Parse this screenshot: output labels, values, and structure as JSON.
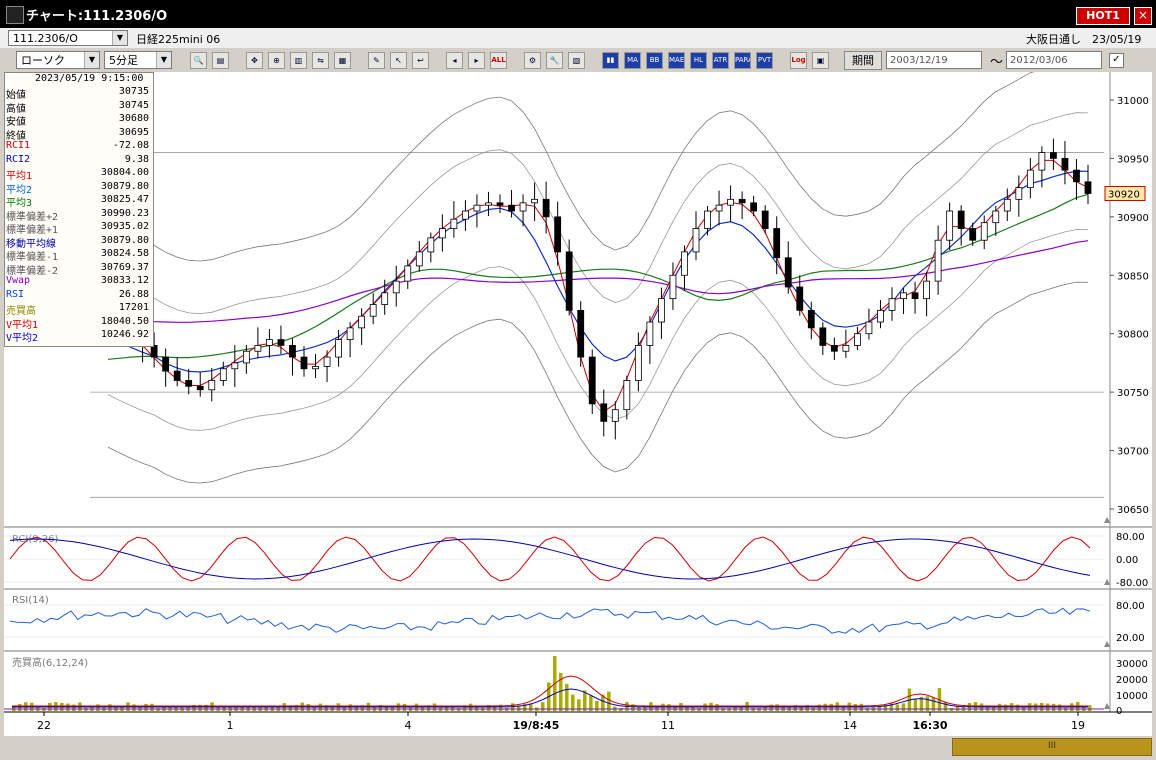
{
  "window": {
    "title": "チャート:111.2306/O",
    "hot_label": "HOT1",
    "close_label": "×"
  },
  "symbol": {
    "code": "111.2306/O",
    "instrument": "日経225mini 06",
    "exchange_date": "大阪日通し　23/05/19"
  },
  "controls": {
    "chart_type": "ローソク",
    "interval": "5分足",
    "period_label": "期間",
    "date_from": "2003/12/19",
    "date_to": "2012/03/06",
    "tilde": "～",
    "toolbar_buttons": [
      {
        "icon": "search-icon",
        "text": "🔍"
      },
      {
        "icon": "split-icon",
        "text": "▤"
      },
      {
        "icon": "cross-icon",
        "text": "✥"
      },
      {
        "icon": "zoom-icon",
        "text": "⊕"
      },
      {
        "icon": "bars-icon",
        "text": "▥"
      },
      {
        "icon": "compare-icon",
        "text": "⇋"
      },
      {
        "icon": "note-icon",
        "text": "▦"
      },
      {
        "icon": "pen-icon",
        "text": "✎"
      },
      {
        "icon": "cursor-icon",
        "text": "↖"
      },
      {
        "icon": "arrow-icon",
        "text": "↩"
      },
      {
        "icon": "candle-left-icon",
        "text": "◂"
      },
      {
        "icon": "candle-right-icon",
        "text": "▸"
      },
      {
        "icon": "all-icon",
        "text": "ALL"
      },
      {
        "icon": "settings-icon",
        "text": "⚙"
      },
      {
        "icon": "wrench-icon",
        "text": "🔧"
      },
      {
        "icon": "palette-icon",
        "text": "▧"
      },
      {
        "icon": "vol-icon",
        "text": "▮▮"
      },
      {
        "icon": "ma-icon",
        "text": "MA"
      },
      {
        "icon": "bb-icon",
        "text": "BB"
      },
      {
        "icon": "mae-icon",
        "text": "MAE"
      },
      {
        "icon": "hl-icon",
        "text": "HL"
      },
      {
        "icon": "atr-icon",
        "text": "ATR"
      },
      {
        "icon": "para-icon",
        "text": "PARA"
      },
      {
        "icon": "pvt-icon",
        "text": "PVT"
      },
      {
        "icon": "log-icon",
        "text": "Log"
      },
      {
        "icon": "window-icon",
        "text": "▣"
      }
    ]
  },
  "info_panel": {
    "datetime": "2023/05/19 9:15:00",
    "rows": [
      {
        "label": "始値",
        "value": "30735",
        "color": "#000000"
      },
      {
        "label": "高値",
        "value": "30745",
        "color": "#000000"
      },
      {
        "label": "安値",
        "value": "30680",
        "color": "#000000"
      },
      {
        "label": "終値",
        "value": "30695",
        "color": "#000000"
      },
      {
        "label": "RCI1",
        "value": "-72.08",
        "color": "#cc0000"
      },
      {
        "label": "RCI2",
        "value": "9.38",
        "color": "#0000cc"
      },
      {
        "label": "平均1",
        "value": "30804.00",
        "color": "#cc0000"
      },
      {
        "label": "平均2",
        "value": "30879.80",
        "color": "#0066cc"
      },
      {
        "label": "平均3",
        "value": "30825.47",
        "color": "#007700"
      },
      {
        "label": "標準偏差+2",
        "value": "30990.23",
        "color": "#555555"
      },
      {
        "label": "標準偏差+1",
        "value": "30935.02",
        "color": "#555555"
      },
      {
        "label": "移動平均線",
        "value": "30879.80",
        "color": "#0000aa"
      },
      {
        "label": "標準偏差-1",
        "value": "30824.58",
        "color": "#555555"
      },
      {
        "label": "標準偏差-2",
        "value": "30769.37",
        "color": "#555555"
      },
      {
        "label": "Vwap",
        "value": "30833.12",
        "color": "#8800cc"
      },
      {
        "label": "RSI",
        "value": "26.88",
        "color": "#0044cc"
      },
      {
        "label": "売買高",
        "value": "17201",
        "color": "#888800"
      },
      {
        "label": "V平均1",
        "value": "18040.50",
        "color": "#cc0000"
      },
      {
        "label": "V平均2",
        "value": "10246.92",
        "color": "#0000cc"
      }
    ]
  },
  "chart_data": [
    {
      "type": "candlestick",
      "title": "",
      "ylim": [
        30650,
        31000
      ],
      "y_ticks": [
        "31000",
        "30950",
        "30900",
        "30850",
        "30800",
        "30750",
        "30700",
        "30650"
      ],
      "x_ticks": [
        "22",
        "1",
        "4",
        "19/8:45",
        "11",
        "14",
        "16:30",
        "19"
      ],
      "last_price_label": "30920",
      "close_series": [
        30812,
        30808,
        30800,
        30790,
        30780,
        30768,
        30760,
        30755,
        30752,
        30760,
        30770,
        30775,
        30785,
        30790,
        30795,
        30790,
        30780,
        30770,
        30772,
        30780,
        30795,
        30805,
        30815,
        30825,
        30835,
        30845,
        30858,
        30870,
        30882,
        30890,
        30898,
        30905,
        30910,
        30912,
        30910,
        30905,
        30912,
        30915,
        30900,
        30870,
        30820,
        30780,
        30740,
        30725,
        30735,
        30760,
        30790,
        30810,
        30830,
        30850,
        30870,
        30890,
        30905,
        30910,
        30915,
        30912,
        30905,
        30890,
        30865,
        30840,
        30820,
        30805,
        30790,
        30785,
        30790,
        30800,
        30810,
        30820,
        30830,
        30835,
        30830,
        30845,
        30880,
        30905,
        30890,
        30880,
        30895,
        30905,
        30915,
        30925,
        30940,
        30955,
        30950,
        30940,
        30930,
        30920
      ]
    },
    {
      "type": "line",
      "title": "RCI(9,26)",
      "y_ticks": [
        "80.00",
        "0.00",
        "-80.00"
      ]
    },
    {
      "type": "line",
      "title": "RSI(14)",
      "y_ticks": [
        "80.00",
        "20.00"
      ]
    },
    {
      "type": "bar",
      "title": "売買高(6,12,24)",
      "y_ticks": [
        "30000",
        "20000",
        "10000",
        "0"
      ]
    }
  ],
  "scroll": {
    "label": "III"
  }
}
